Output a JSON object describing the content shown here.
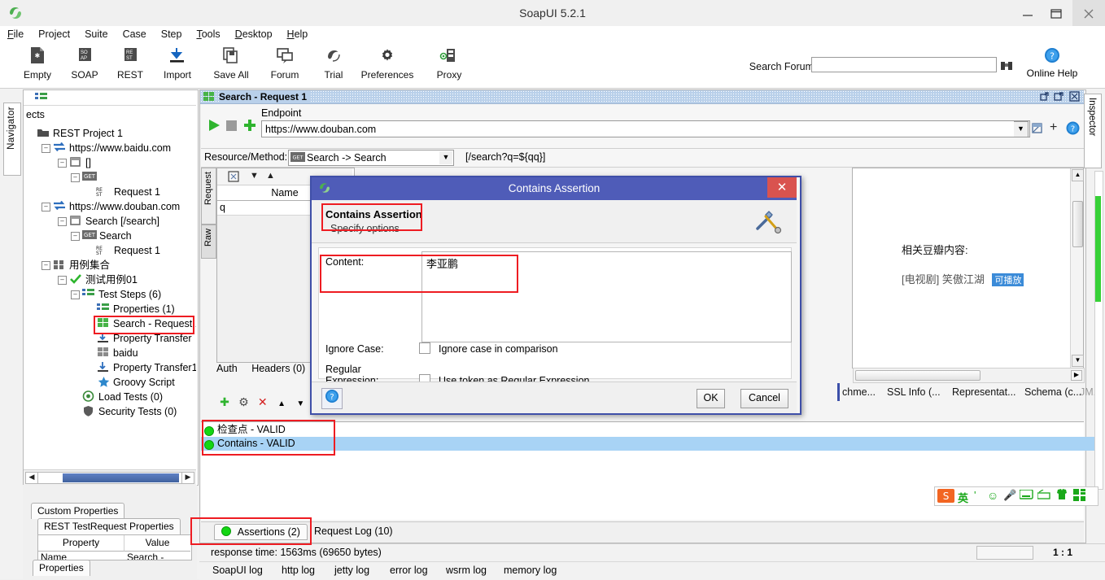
{
  "window": {
    "title": "SoapUI 5.2.1",
    "logo_icon": "soapui-logo-icon",
    "minimize_icon": "minimize-icon",
    "maximize_icon": "maximize-icon",
    "close_icon": "close-icon"
  },
  "menu": [
    "File",
    "Project",
    "Suite",
    "Case",
    "Step",
    "Tools",
    "Desktop",
    "Help"
  ],
  "toolbar": {
    "buttons": [
      {
        "label": "Empty",
        "icon": "empty-project-icon"
      },
      {
        "label": "SOAP",
        "icon": "soap-project-icon"
      },
      {
        "label": "REST",
        "icon": "rest-project-icon"
      },
      {
        "label": "Import",
        "icon": "import-icon"
      },
      {
        "label": "Save All",
        "icon": "save-all-icon"
      },
      {
        "label": "Forum",
        "icon": "forum-icon"
      },
      {
        "label": "Trial",
        "icon": "trial-icon"
      },
      {
        "label": "Preferences",
        "icon": "gear-icon"
      },
      {
        "label": "Proxy",
        "icon": "proxy-icon"
      }
    ],
    "search_forum_label": "Search Forum",
    "search_forum_value": "",
    "search_forum_placeholder": "",
    "search_forum_icon": "binoculars-icon",
    "online_help_label": "Online Help",
    "online_help_icon": "help-circle-icon"
  },
  "navigator": {
    "tab_label": "Navigator",
    "toolbar_icon": "list-icon",
    "header_clipped": "ects",
    "tree": [
      {
        "label": "REST Project 1",
        "icon": "project-folder-icon",
        "depth": 0
      },
      {
        "label": "https://www.baidu.com",
        "icon": "service-icon",
        "depth": 1
      },
      {
        "label": "[]",
        "icon": "resource-icon",
        "depth": 2
      },
      {
        "label": "",
        "icon": "get-method-icon",
        "depth": 3
      },
      {
        "label": "Request 1",
        "icon": "rest-request-icon",
        "depth": 4
      },
      {
        "label": "https://www.douban.com",
        "icon": "service-icon",
        "depth": 1
      },
      {
        "label": "Search [/search]",
        "icon": "resource-icon",
        "depth": 2
      },
      {
        "label": "Search",
        "icon": "get-method-icon",
        "depth": 3
      },
      {
        "label": "Request 1",
        "icon": "rest-request-icon",
        "depth": 4
      },
      {
        "label": "用例集合",
        "icon": "testsuite-icon",
        "depth": 1
      },
      {
        "label": "测试用例01",
        "icon": "check-green-icon",
        "depth": 2
      },
      {
        "label": "Test Steps (6)",
        "icon": "teststeps-icon",
        "depth": 3
      },
      {
        "label": "Properties (1)",
        "icon": "properties-step-icon",
        "depth": 4
      },
      {
        "label": "Search - Request 1",
        "icon": "rest-test-request-icon",
        "depth": 4,
        "selected": true
      },
      {
        "label": "Property Transfer",
        "icon": "property-transfer-icon",
        "depth": 4
      },
      {
        "label": "baidu",
        "icon": "rest-test-request-icon",
        "depth": 4
      },
      {
        "label": "Property Transfer1",
        "icon": "property-transfer-icon",
        "depth": 4
      },
      {
        "label": "Groovy Script",
        "icon": "groovy-star-icon",
        "depth": 4
      },
      {
        "label": "Load Tests (0)",
        "icon": "load-tests-icon",
        "depth": 3
      },
      {
        "label": "Security Tests (0)",
        "icon": "security-tests-icon",
        "depth": 3
      }
    ],
    "hscroll_left_icon": "arrow-left-icon",
    "hscroll_right_icon": "arrow-right-icon"
  },
  "properties_panel": {
    "tab_custom": "Custom Properties",
    "tab_rest": "REST TestRequest Properties",
    "columns": [
      "Property",
      "Value"
    ],
    "rows": [
      [
        "Name",
        "Search - Requ..."
      ]
    ],
    "bottom_tab": "Properties"
  },
  "desktop": {
    "tab_title": "Search - Request 1",
    "tab_icon": "rest-test-request-icon",
    "win_restore_icon": "restore-icon",
    "win_maximize_icon": "maximize-panel-icon",
    "win_close_icon": "close-panel-icon",
    "run_icon": "run-play-icon",
    "stop_icon": "stop-icon",
    "add_icon": "plus-green-icon",
    "endpoint_label": "Endpoint",
    "endpoint_value": "https://www.douban.com",
    "endpoint_dropdown_icon": "chevron-down-icon",
    "toolbar_right": [
      {
        "icon": "endpoint-config-icon"
      },
      {
        "icon": "plus-icon"
      },
      {
        "icon": "help-circle-icon"
      }
    ],
    "resource_method_label": "Resource/Method:",
    "resource_method_value": "Search -> Search",
    "resource_method_icon": "get-method-icon",
    "resource_method_dropdown_icon": "chevron-down-icon",
    "path_preview": "[/search?q=${qq}]",
    "request_vtab": "Request",
    "raw_vtab": "Raw",
    "params_toolbar_icons": [
      "expand-icon",
      "move-down-icon",
      "move-up-icon"
    ],
    "params_header": "Name",
    "params_rows": [
      "q"
    ],
    "params_tabs": [
      "Auth",
      "Headers (0)"
    ],
    "params_buttons": [
      "plus-green-icon",
      "gear-icon",
      "delete-red-x-icon",
      "move-up-icon",
      "move-down-icon"
    ],
    "response_text_title": "相关豆瓣内容:",
    "response_text_line": "[电视剧] 笑傲江湖",
    "response_badge": "可播放",
    "response_tabs": [
      "chme...",
      "SSL Info (...",
      "Representat...",
      "Schema (c...",
      "JM..."
    ],
    "online_help_label": "Online Help",
    "online_help_icon": "help-circle-icon"
  },
  "assertions": {
    "rows": [
      {
        "label": "检查点 - VALID",
        "status": "VALID",
        "status_color": "#13d613",
        "selected": false
      },
      {
        "label": "Contains - VALID",
        "status": "VALID",
        "status_color": "#13d613",
        "selected": true
      }
    ],
    "tabs": [
      {
        "label": "Assertions (2)",
        "active": true,
        "icon": "green-dot-icon"
      },
      {
        "label": "Request Log (10)",
        "active": false
      }
    ]
  },
  "statusbar": {
    "response_time": "response time: 1563ms (69650 bytes)",
    "ratio": "1 : 1",
    "log_tabs": [
      "SoapUI log",
      "http log",
      "jetty log",
      "error log",
      "wsrm log",
      "memory log"
    ]
  },
  "inspector": {
    "tab_label": "Inspector"
  },
  "ime": {
    "icons": [
      "sogou-logo-icon",
      "chinese-english-toggle-icon",
      "punctuation-icon",
      "emoji-icon",
      "microphone-icon",
      "keyboard-icon",
      "handwriting-icon",
      "skin-icon",
      "toolbox-icon"
    ],
    "mode_label": "英"
  },
  "dialog": {
    "titlebar_title": "Contains Assertion",
    "titlebar_icon": "soapui-logo-icon",
    "close_icon": "close-icon",
    "header_title": "Contains Assertion",
    "header_subtitle": "Specify options",
    "header_icon": "wrench-tools-icon",
    "content_label": "Content:",
    "content_value": "李亚鹏",
    "ignore_case_label": "Ignore Case:",
    "ignore_case_checkbox_label": "Ignore case in comparison",
    "ignore_case_checked": false,
    "regex_label": "Regular Expression:",
    "regex_checkbox_label": "Use token as Regular Expression",
    "regex_checked": false,
    "help_icon": "help-circle-icon",
    "ok_label": "OK",
    "cancel_label": "Cancel"
  },
  "colors": {
    "dialog_titlebar": "#4f5cb8",
    "dialog_close": "#d9534f",
    "highlight_red": "#ee1c22",
    "selection_blue": "#a8d3f5",
    "valid_green": "#13d613"
  }
}
